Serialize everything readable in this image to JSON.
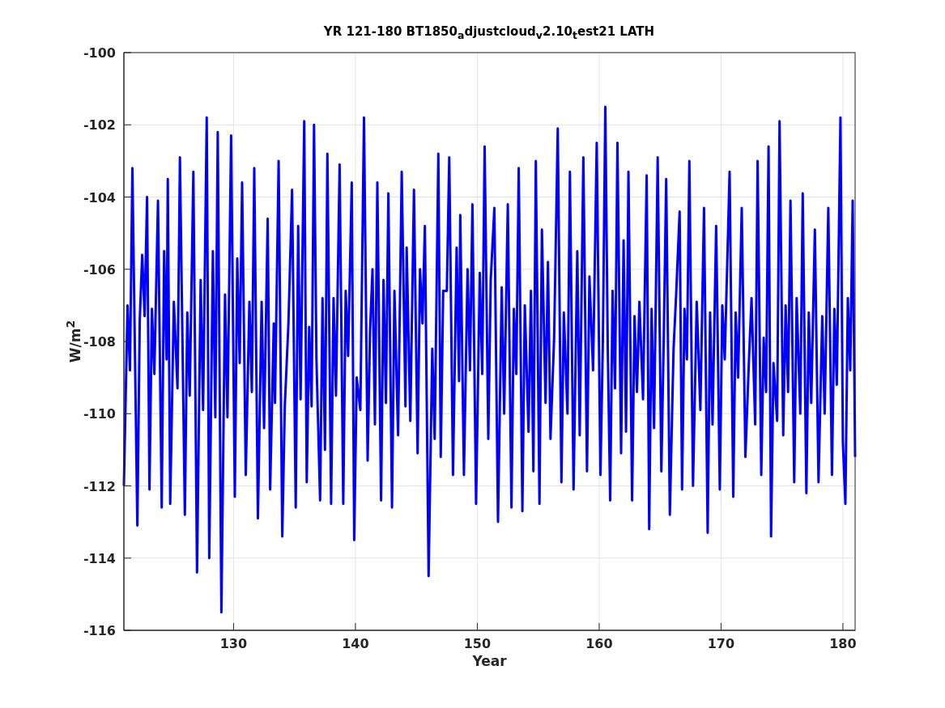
{
  "figure": {
    "chart_data": {
      "type": "line",
      "title": "YR 121-180 BT1850$_{a}$djustcloud$_{v}$2.10$_{t}$est21 LATH",
      "xlabel": "Year",
      "ylabel": "W/m$^{2}$",
      "xlim": [
        121,
        181
      ],
      "ylim": [
        -116,
        -100
      ],
      "xticks": [
        130,
        140,
        150,
        160,
        170,
        180
      ],
      "yticks": [
        -116,
        -114,
        -112,
        -110,
        -108,
        -106,
        -104,
        -102,
        -100
      ],
      "x": [
        121.0,
        121.3,
        121.5,
        121.7,
        122.1,
        122.3,
        122.5,
        122.7,
        122.9,
        123.1,
        123.3,
        123.5,
        123.8,
        124.1,
        124.3,
        124.5,
        124.6,
        124.8,
        125.1,
        125.4,
        125.6,
        126.0,
        126.2,
        126.4,
        126.7,
        127.0,
        127.3,
        127.5,
        127.8,
        128.0,
        128.3,
        128.5,
        128.7,
        129.0,
        129.3,
        129.5,
        129.8,
        130.1,
        130.3,
        130.5,
        130.7,
        131.0,
        131.3,
        131.5,
        131.7,
        132.0,
        132.3,
        132.5,
        132.8,
        133.0,
        133.3,
        133.4,
        133.7,
        134.0,
        134.2,
        134.5,
        134.8,
        135.1,
        135.3,
        135.5,
        135.8,
        136.0,
        136.2,
        136.4,
        136.6,
        136.8,
        137.1,
        137.3,
        137.5,
        137.7,
        138.0,
        138.2,
        138.4,
        138.7,
        139.0,
        139.2,
        139.4,
        139.7,
        139.9,
        140.1,
        140.4,
        140.7,
        141.0,
        141.2,
        141.4,
        141.6,
        141.8,
        142.1,
        142.3,
        142.5,
        142.7,
        143.0,
        143.2,
        143.5,
        143.8,
        144.1,
        144.2,
        144.5,
        144.8,
        145.1,
        145.3,
        145.5,
        145.7,
        146.0,
        146.3,
        146.5,
        146.8,
        147.0,
        147.2,
        147.5,
        147.7,
        148.0,
        148.3,
        148.5,
        148.6,
        148.9,
        149.2,
        149.4,
        149.6,
        149.9,
        150.2,
        150.4,
        150.6,
        150.9,
        151.1,
        151.4,
        151.7,
        152.0,
        152.2,
        152.5,
        152.8,
        153.0,
        153.2,
        153.4,
        153.7,
        153.9,
        154.2,
        154.4,
        154.6,
        154.8,
        155.1,
        155.3,
        155.6,
        155.8,
        156.0,
        156.3,
        156.6,
        156.9,
        157.1,
        157.4,
        157.6,
        157.9,
        158.2,
        158.4,
        158.7,
        159.0,
        159.2,
        159.5,
        159.8,
        160.1,
        160.3,
        160.5,
        160.7,
        160.9,
        161.1,
        161.3,
        161.5,
        161.8,
        162.0,
        162.2,
        162.4,
        162.7,
        162.9,
        163.1,
        163.3,
        163.6,
        163.9,
        164.1,
        164.3,
        164.5,
        164.8,
        165.1,
        165.3,
        165.5,
        165.8,
        166.1,
        166.3,
        166.6,
        166.8,
        167.0,
        167.2,
        167.4,
        167.7,
        168.0,
        168.3,
        168.6,
        168.9,
        169.1,
        169.3,
        169.6,
        169.9,
        170.1,
        170.3,
        170.7,
        171.0,
        171.2,
        171.4,
        171.7,
        172.0,
        172.3,
        172.5,
        172.8,
        173.0,
        173.3,
        173.5,
        173.7,
        173.9,
        174.1,
        174.3,
        174.6,
        174.8,
        175.1,
        175.3,
        175.5,
        175.7,
        176.0,
        176.2,
        176.5,
        176.7,
        177.0,
        177.2,
        177.4,
        177.7,
        178.0,
        178.3,
        178.5,
        178.8,
        179.1,
        179.3,
        179.5,
        179.8,
        180.0,
        180.2,
        180.4,
        180.6,
        180.8,
        181.0
      ],
      "grid": true,
      "series": [
        {
          "color": "#0000ff",
          "values": [
            -112,
            -107,
            -108.8,
            -103.2,
            -113.1,
            -107.4,
            -105.6,
            -107.3,
            -104,
            -112.1,
            -107.1,
            -108.9,
            -104.1,
            -112.6,
            -105.5,
            -108.5,
            -103.5,
            -112.5,
            -106.9,
            -109.3,
            -102.9,
            -112.8,
            -107.2,
            -109.5,
            -103.3,
            -114.4,
            -106.3,
            -109.9,
            -101.8,
            -114,
            -105.5,
            -110.1,
            -102.2,
            -115.5,
            -106.7,
            -110.1,
            -102.3,
            -112.3,
            -105.7,
            -108.6,
            -103.6,
            -111.7,
            -106.9,
            -109.4,
            -103.2,
            -112.9,
            -106.9,
            -110.4,
            -104.6,
            -112.1,
            -107.5,
            -109.7,
            -103,
            -113.4,
            -109.8,
            -107.5,
            -103.8,
            -112.6,
            -104.8,
            -109.6,
            -101.9,
            -111.9,
            -107.6,
            -109.8,
            -102,
            -108.5,
            -112.4,
            -106.8,
            -111,
            -102.8,
            -112.5,
            -106.8,
            -109.5,
            -103.1,
            -112.5,
            -106.6,
            -108.4,
            -103.6,
            -113.5,
            -109,
            -109.9,
            -101.8,
            -111.3,
            -107.7,
            -106,
            -110.3,
            -103.6,
            -112.4,
            -106.3,
            -109.7,
            -103.9,
            -112.6,
            -106.6,
            -110.6,
            -103.3,
            -109.8,
            -105.4,
            -110.2,
            -103.8,
            -111.1,
            -106,
            -107.5,
            -104.8,
            -114.5,
            -108.2,
            -110.7,
            -102.8,
            -111.2,
            -106.6,
            -106.6,
            -102.9,
            -111.7,
            -105.4,
            -109.1,
            -104.5,
            -111.7,
            -106,
            -108.8,
            -104.2,
            -112.5,
            -106.1,
            -108.9,
            -102.6,
            -110.7,
            -106.3,
            -104.3,
            -113,
            -106.5,
            -110,
            -104.2,
            -112.6,
            -107.1,
            -108.9,
            -103.2,
            -112.7,
            -107,
            -110.5,
            -106.6,
            -111.6,
            -103,
            -112.5,
            -104.9,
            -109.7,
            -105.8,
            -110.7,
            -107.9,
            -102.1,
            -111.9,
            -107.2,
            -110,
            -103.3,
            -112.1,
            -105.5,
            -110.6,
            -102.9,
            -111.6,
            -106.2,
            -108.8,
            -102.5,
            -111.7,
            -108,
            -101.5,
            -108.1,
            -112.4,
            -106.6,
            -109.3,
            -102.5,
            -111.1,
            -105.2,
            -110.5,
            -103.3,
            -112.4,
            -107.3,
            -109.4,
            -106.9,
            -109.6,
            -103.4,
            -113.2,
            -107.1,
            -110.4,
            -102.9,
            -111.6,
            -107.9,
            -103.5,
            -112.8,
            -108.2,
            -106.8,
            -104.4,
            -112.1,
            -107.1,
            -108.5,
            -103,
            -112,
            -106.9,
            -109.9,
            -104.3,
            -113.3,
            -107.2,
            -110.3,
            -104.8,
            -112.1,
            -107,
            -108.5,
            -103.3,
            -112.3,
            -107.2,
            -109,
            -104.3,
            -111.2,
            -108.4,
            -106.8,
            -110.3,
            -103,
            -111.7,
            -107.9,
            -109.4,
            -102.6,
            -113.4,
            -108.6,
            -110.2,
            -101.9,
            -110.6,
            -107,
            -109.4,
            -104.1,
            -111.9,
            -106.8,
            -110,
            -103.9,
            -112.2,
            -107.2,
            -109.7,
            -104.9,
            -111.9,
            -107.3,
            -110,
            -104.3,
            -111.7,
            -107.1,
            -109.2,
            -101.8,
            -110.8,
            -112.5,
            -106.8,
            -108.8,
            -104.1,
            -111.2
          ]
        }
      ]
    }
  }
}
